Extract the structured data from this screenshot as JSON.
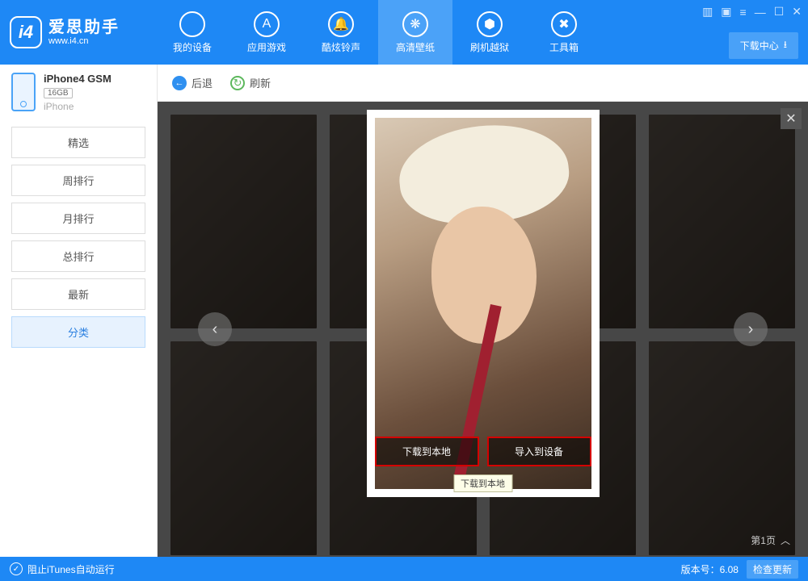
{
  "brand": {
    "logo_letter": "i4",
    "name_cn": "爱思助手",
    "name_en": "www.i4.cn"
  },
  "nav": {
    "items": [
      {
        "label": "我的设备"
      },
      {
        "label": "应用游戏"
      },
      {
        "label": "酷炫铃声"
      },
      {
        "label": "高清壁纸"
      },
      {
        "label": "刷机越狱"
      },
      {
        "label": "工具箱"
      }
    ],
    "active_index": 3
  },
  "download_center": "下载中心",
  "device": {
    "name": "iPhone4 GSM",
    "capacity": "16GB",
    "type": "iPhone"
  },
  "categories": {
    "items": [
      "精选",
      "周排行",
      "月排行",
      "总排行",
      "最新",
      "分类"
    ],
    "selected_index": 5
  },
  "toolbar": {
    "back": "后退",
    "refresh": "刷新"
  },
  "preview": {
    "download_local": "下载到本地",
    "import_device": "导入到设备",
    "tooltip": "下载到本地"
  },
  "pager": {
    "label": "第1页"
  },
  "status": {
    "itunes_block": "阻止iTunes自动运行",
    "version_label": "版本号：",
    "version": "6.08",
    "check_update": "检查更新"
  }
}
